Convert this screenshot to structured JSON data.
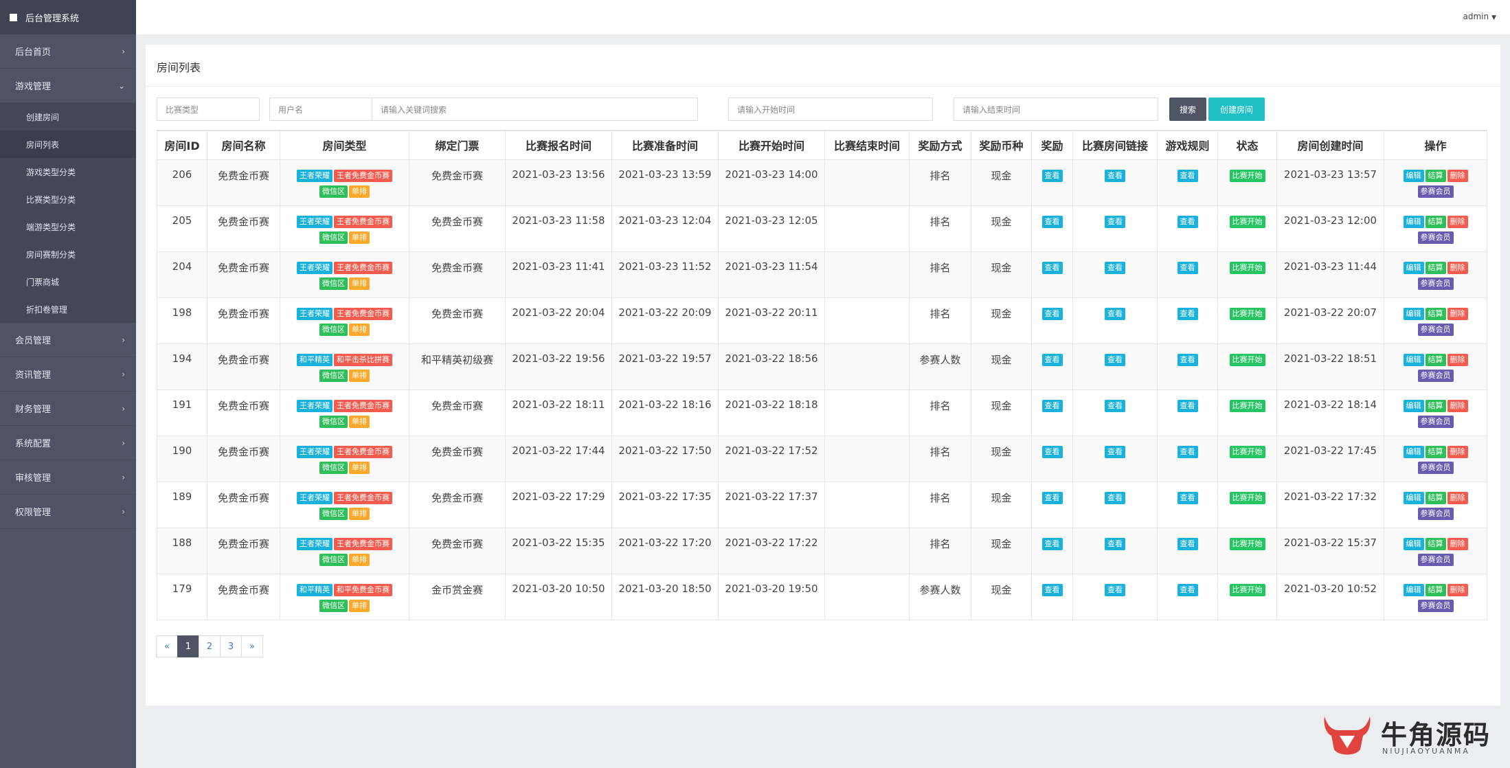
{
  "brand": {
    "title": "后台管理系统"
  },
  "sidebar": {
    "items": [
      {
        "label": "后台首页",
        "chevron": "›"
      },
      {
        "label": "游戏管理",
        "chevron": "⌄"
      },
      {
        "label": "会员管理",
        "chevron": "›"
      },
      {
        "label": "资讯管理",
        "chevron": "›"
      },
      {
        "label": "财务管理",
        "chevron": "›"
      },
      {
        "label": "系统配置",
        "chevron": "›"
      },
      {
        "label": "审核管理",
        "chevron": "›"
      },
      {
        "label": "权限管理",
        "chevron": "›"
      }
    ],
    "submenu": [
      "创建房间",
      "房间列表",
      "游戏类型分类",
      "比赛类型分类",
      "端游类型分类",
      "房间赛制分类",
      "门票商城",
      "折扣卷管理"
    ]
  },
  "topbar": {
    "user": "admin",
    "caret": "▼"
  },
  "page": {
    "title": "房间列表"
  },
  "filters": {
    "match_type": "比赛类型",
    "username": "用户名",
    "keyword_placeholder": "请输入关键词搜索",
    "start_placeholder": "请输入开始时间",
    "end_placeholder": "请输入结束时间",
    "search_btn": "搜索",
    "create_btn": "创建房间"
  },
  "table": {
    "headers": [
      "房间ID",
      "房间名称",
      "房间类型",
      "绑定门票",
      "比赛报名时间",
      "比赛准备时间",
      "比赛开始时间",
      "比赛结束时间",
      "奖励方式",
      "奖励币种",
      "奖励",
      "比赛房间链接",
      "游戏规则",
      "状态",
      "房间创建时间",
      "操作"
    ],
    "view_label": "查看",
    "status_label": "比赛开始",
    "actions": {
      "edit": "编辑",
      "settle": "结算",
      "delete": "删除",
      "members": "参赛会员"
    },
    "rows": [
      {
        "id": "206",
        "name": "免费金币赛",
        "tag1": "王者荣耀",
        "tag2": "王者免费金币赛",
        "tag3": "微信区",
        "tag4": "单排",
        "ticket": "免费金币赛",
        "signup": "2021-03-23 13:56",
        "ready": "2021-03-23 13:59",
        "start": "2021-03-23 14:00",
        "end": "",
        "reward_way": "排名",
        "currency": "现金",
        "created": "2021-03-23 13:57"
      },
      {
        "id": "205",
        "name": "免费金币赛",
        "tag1": "王者荣耀",
        "tag2": "王者免费金币赛",
        "tag3": "微信区",
        "tag4": "单排",
        "ticket": "免费金币赛",
        "signup": "2021-03-23 11:58",
        "ready": "2021-03-23 12:04",
        "start": "2021-03-23 12:05",
        "end": "",
        "reward_way": "排名",
        "currency": "现金",
        "created": "2021-03-23 12:00"
      },
      {
        "id": "204",
        "name": "免费金币赛",
        "tag1": "王者荣耀",
        "tag2": "王者免费金币赛",
        "tag3": "微信区",
        "tag4": "单排",
        "ticket": "免费金币赛",
        "signup": "2021-03-23 11:41",
        "ready": "2021-03-23 11:52",
        "start": "2021-03-23 11:54",
        "end": "",
        "reward_way": "排名",
        "currency": "现金",
        "created": "2021-03-23 11:44"
      },
      {
        "id": "198",
        "name": "免费金币赛",
        "tag1": "王者荣耀",
        "tag2": "王者免费金币赛",
        "tag3": "微信区",
        "tag4": "单排",
        "ticket": "免费金币赛",
        "signup": "2021-03-22 20:04",
        "ready": "2021-03-22 20:09",
        "start": "2021-03-22 20:11",
        "end": "",
        "reward_way": "排名",
        "currency": "现金",
        "created": "2021-03-22 20:07"
      },
      {
        "id": "194",
        "name": "免费金币赛",
        "tag1": "和平精英",
        "tag2": "和平击杀比拼赛",
        "tag3": "微信区",
        "tag4": "单排",
        "ticket": "和平精英初级赛",
        "signup": "2021-03-22 19:56",
        "ready": "2021-03-22 19:57",
        "start": "2021-03-22 18:56",
        "end": "",
        "reward_way": "参赛人数",
        "currency": "现金",
        "created": "2021-03-22 18:51"
      },
      {
        "id": "191",
        "name": "免费金币赛",
        "tag1": "王者荣耀",
        "tag2": "王者免费金币赛",
        "tag3": "微信区",
        "tag4": "单排",
        "ticket": "免费金币赛",
        "signup": "2021-03-22 18:11",
        "ready": "2021-03-22 18:16",
        "start": "2021-03-22 18:18",
        "end": "",
        "reward_way": "排名",
        "currency": "现金",
        "created": "2021-03-22 18:14"
      },
      {
        "id": "190",
        "name": "免费金币赛",
        "tag1": "王者荣耀",
        "tag2": "王者免费金币赛",
        "tag3": "微信区",
        "tag4": "单排",
        "ticket": "免费金币赛",
        "signup": "2021-03-22 17:44",
        "ready": "2021-03-22 17:50",
        "start": "2021-03-22 17:52",
        "end": "",
        "reward_way": "排名",
        "currency": "现金",
        "created": "2021-03-22 17:45"
      },
      {
        "id": "189",
        "name": "免费金币赛",
        "tag1": "王者荣耀",
        "tag2": "王者免费金币赛",
        "tag3": "微信区",
        "tag4": "单排",
        "ticket": "免费金币赛",
        "signup": "2021-03-22 17:29",
        "ready": "2021-03-22 17:35",
        "start": "2021-03-22 17:37",
        "end": "",
        "reward_way": "排名",
        "currency": "现金",
        "created": "2021-03-22 17:32"
      },
      {
        "id": "188",
        "name": "免费金币赛",
        "tag1": "王者荣耀",
        "tag2": "王者免费金币赛",
        "tag3": "微信区",
        "tag4": "单排",
        "ticket": "免费金币赛",
        "signup": "2021-03-22 15:35",
        "ready": "2021-03-22 17:20",
        "start": "2021-03-22 17:22",
        "end": "",
        "reward_way": "排名",
        "currency": "现金",
        "created": "2021-03-22 15:37"
      },
      {
        "id": "179",
        "name": "免费金币赛",
        "tag1": "和平精英",
        "tag2": "和平免费金币赛",
        "tag3": "微信区",
        "tag4": "单排",
        "ticket": "金币赏金赛",
        "signup": "2021-03-20 10:50",
        "ready": "2021-03-20 18:50",
        "start": "2021-03-20 19:50",
        "end": "",
        "reward_way": "参赛人数",
        "currency": "现金",
        "created": "2021-03-20 10:52"
      }
    ]
  },
  "pagination": [
    "«",
    "1",
    "2",
    "3",
    "»"
  ],
  "watermark": {
    "cn": "牛角源码",
    "en": "NIUJIAOYUANMA"
  },
  "colors": {
    "sidebar": "#4f5465",
    "accent": "#1fc1c6",
    "tag_cyan": "#1ab2dd",
    "tag_red": "#f25c4f",
    "tag_green": "#2fbf5a",
    "tag_orange": "#f9aa2c",
    "tag_purple": "#6a5bb0"
  }
}
